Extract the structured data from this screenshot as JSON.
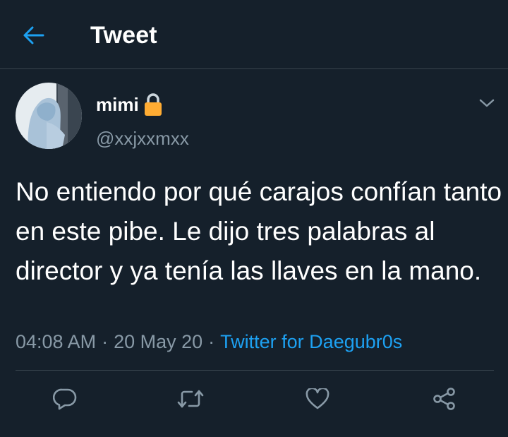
{
  "header": {
    "title": "Tweet",
    "back_icon": "arrow-left-icon",
    "accent_color": "#1da1f2"
  },
  "tweet": {
    "display_name": "mimi",
    "handle": "@xxjxxmxx",
    "text": "No entiendo por qué carajos confían tanto en este pibe. Le dijo tres palabras al director y ya tenía las llaves en la mano.",
    "time": "04:08 AM",
    "date": "20 May 20",
    "source": "Twitter for Daegubr0s",
    "separator": "·"
  },
  "actions": [
    "reply-icon",
    "retweet-icon",
    "like-icon",
    "share-icon"
  ],
  "colors": {
    "background": "#15202b",
    "secondary_text": "#8899a6",
    "divider": "#38444d"
  }
}
